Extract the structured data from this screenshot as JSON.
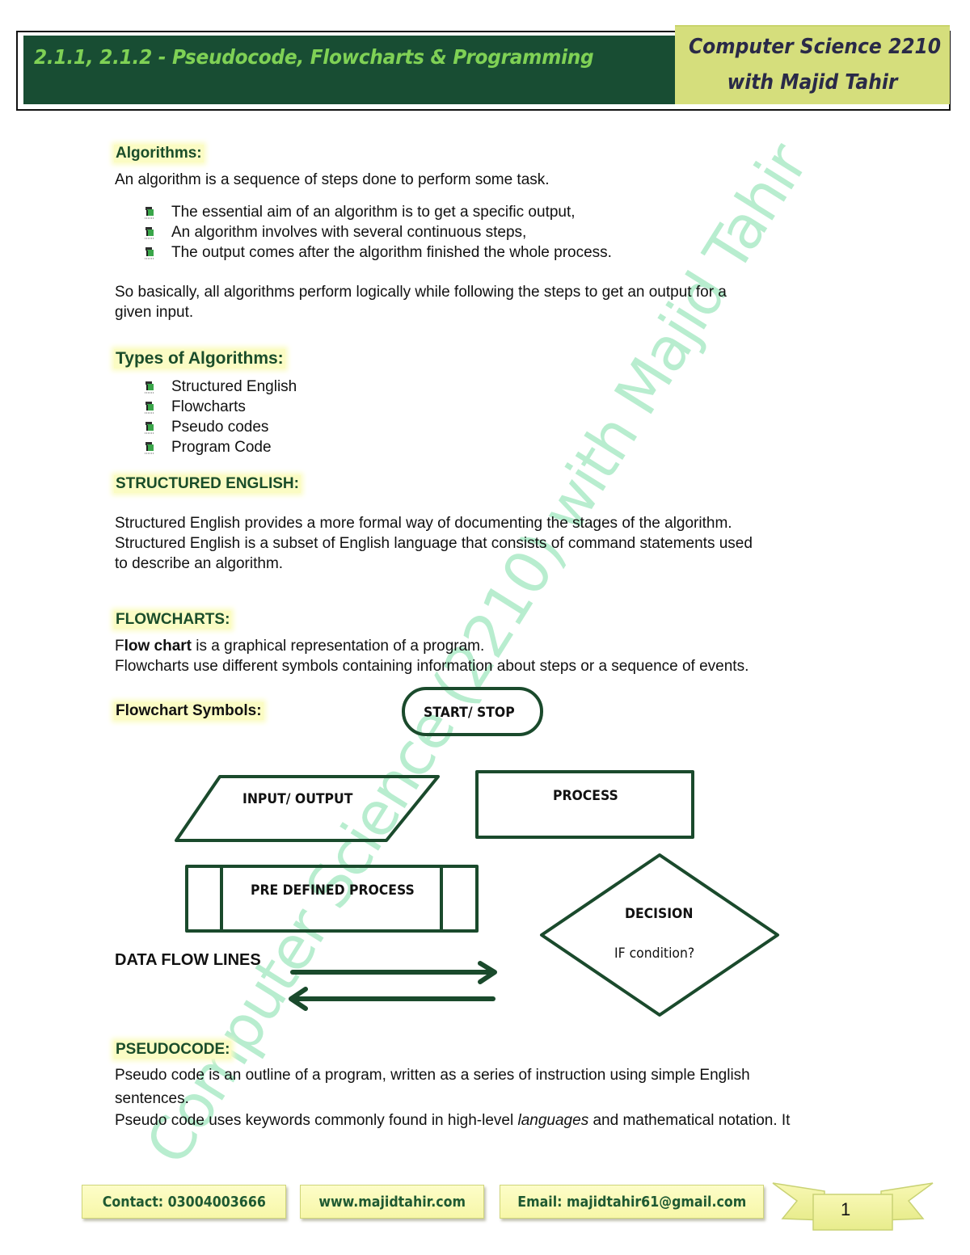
{
  "header": {
    "title": "2.1.1, 2.1.2 - Pseudocode, Flowcharts & Programming",
    "course_line1": "Computer Science 2210",
    "course_line2": "with Majid Tahir"
  },
  "watermark": "Computer Science (2210) with Majid Tahir",
  "algorithms": {
    "heading": "Algorithms:",
    "intro": "An algorithm is a sequence of steps done to perform some task.",
    "bullets": [
      "The essential aim of an algorithm is to get a specific output,",
      "An algorithm involves with several continuous steps,",
      "The output comes after the algorithm finished the whole process."
    ],
    "summary_line1": "So basically, all algorithms perform logically while following the steps to get an output for a",
    "summary_line2": "given input."
  },
  "types": {
    "heading": "Types of Algorithms:",
    "items": [
      "Structured English",
      "Flowcharts",
      "Pseudo codes",
      "Program Code"
    ]
  },
  "structured_english": {
    "heading": "STRUCTURED ENGLISH:",
    "line1": "Structured English provides a more formal way of documenting the stages of the algorithm.",
    "line2": "Structured English is a subset of English language that consists of command statements used",
    "line3": "to describe an algorithm."
  },
  "flowcharts": {
    "heading": "FLOWCHARTS:",
    "line1_prefix": "F",
    "line1_bold": "low chart",
    "line1_rest": " is a graphical representation of a program.",
    "line2": "Flowcharts use different symbols containing information about steps or a sequence of events.",
    "symbols_heading": "Flowchart Symbols:",
    "symbols": {
      "start_stop": "START/ STOP",
      "input_output": "INPUT/ OUTPUT",
      "process": "PROCESS",
      "predefined": "PRE DEFINED PROCESS",
      "decision": "DECISION",
      "decision_sub": "IF condition?",
      "data_flow": "DATA FLOW LINES"
    },
    "stroke_color": "#1a4a2c"
  },
  "pseudocode": {
    "heading": "PSEUDOCODE:",
    "line1": "Pseudo code is an outline of a program, written as a series of instruction using simple English",
    "line2": "sentences.",
    "line3_before": "Pseudo code uses keywords commonly found in high-level ",
    "line3_italic": "languages",
    "line3_after": " and mathematical notation. It"
  },
  "footer": {
    "contact": "Contact: 03004003666",
    "website": "www.majidtahir.com",
    "email": "Email: majidtahir61@gmail.com",
    "page_number": "1"
  }
}
